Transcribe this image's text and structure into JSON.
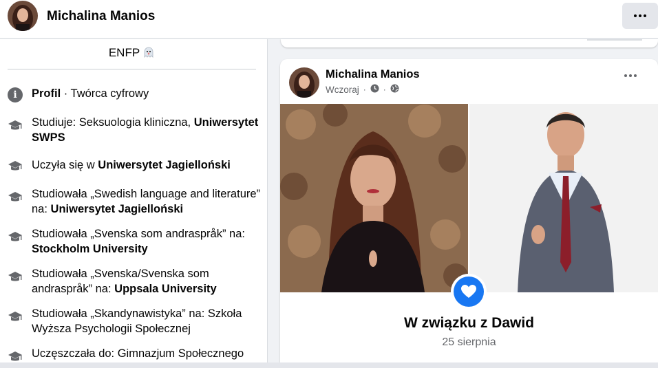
{
  "header": {
    "profile_name": "Michalina Manios"
  },
  "intro": {
    "mbti": "ENFP",
    "items": [
      {
        "icon": "info-icon",
        "bold_prefix": "Profil",
        "text": " · Twórca cyfrowy"
      },
      {
        "icon": "graduation-cap-icon",
        "text": "Studiuje: Seksuologia kliniczna, ",
        "bold": "Uniwersytet SWPS"
      },
      {
        "icon": "graduation-cap-icon",
        "text": "Uczyła się w ",
        "bold": "Uniwersytet Jagielloński"
      },
      {
        "icon": "graduation-cap-icon",
        "text": "Studiowała „Swedish language and literature” na: ",
        "bold": "Uniwersytet Jagielloński"
      },
      {
        "icon": "graduation-cap-icon",
        "text": "Studiowała „Svenska som andraspråk” na: ",
        "bold": "Stockholm University"
      },
      {
        "icon": "graduation-cap-icon",
        "text": "Studiowała „Svenska/Svenska som andraspråk” na: ",
        "bold": "Uppsala University"
      },
      {
        "icon": "graduation-cap-icon",
        "text": "Studiowała „Skandynawistyka” na: Szkoła Wyższa Psychologii Społecznej",
        "bold": ""
      },
      {
        "icon": "graduation-cap-icon",
        "text": "Uczęszczała do: Gimnazjum Społecznego",
        "bold": ""
      }
    ]
  },
  "post": {
    "author": "Michalina Manios",
    "time": "Wczoraj",
    "life_event_title": "W związku z Dawid",
    "life_event_date": "25 sierpnia"
  },
  "colors": {
    "accent": "#1877f2",
    "secondary_text": "#65676b",
    "background": "#f0f2f5"
  }
}
